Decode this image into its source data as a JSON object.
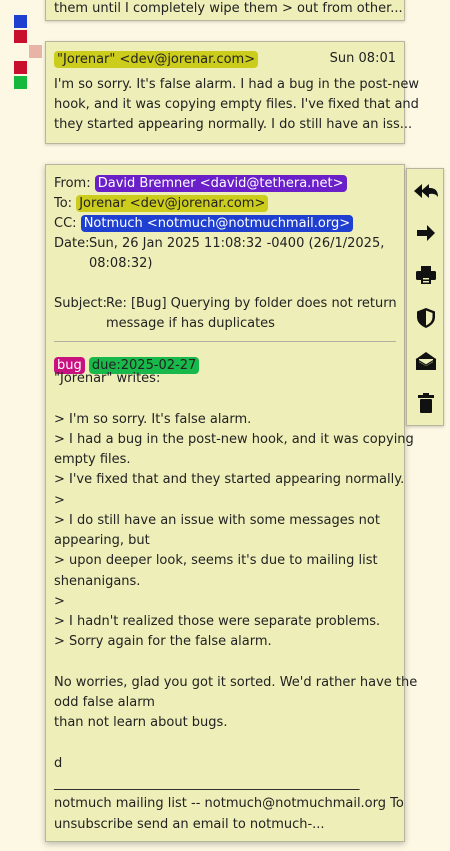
{
  "top_snippet": "them until I completely wipe them > out from other...",
  "color_squares": [
    {
      "name": "blue",
      "color": "#1f3fd0"
    },
    {
      "name": "crimson",
      "color": "#c8102e"
    },
    {
      "name": "pink",
      "color": "#e8b4a8"
    },
    {
      "name": "crimson2",
      "color": "#c8102e"
    },
    {
      "name": "green",
      "color": "#14b83c"
    }
  ],
  "msg1": {
    "from": "\"Jorenar\" <dev@jorenar.com>",
    "date": "Sun 08:01",
    "preview_line1": "I'm so sorry. It's false alarm. I had a bug in the post-new",
    "preview_line2": "hook, and it was copying empty files. I've fixed that and",
    "preview_line3": "they started appearing normally. I do still have an iss..."
  },
  "msg2": {
    "from_label": "From:",
    "from": "David Bremner <david@tethera.net>",
    "to_label": "To:",
    "to": "Jorenar <dev@jorenar.com>",
    "cc_label": "CC:",
    "cc": "Notmuch <notmuch@notmuchmail.org>",
    "date_label": "Date:",
    "date_line1": "Sun, 26 Jan 2025 11:08:32 -0400 (26/1/2025,",
    "date_line2": "08:08:32)",
    "subject_label": "Subject:",
    "subject_line1": "Re: [Bug] Querying by folder does not return",
    "subject_line2": "message if has duplicates",
    "tag1": "bug",
    "tag2": "due:2025-02-27",
    "body": "\"Jorenar\" writes:\n\n> I'm so sorry. It's false alarm.\n> I had a bug in the post-new hook, and it was copying\nempty files.\n> I've fixed that and they started appearing normally.\n>\n> I do still have an issue with some messages not\nappearing, but\n> upon deeper look, seems it's due to mailing list\nshenanigans.\n>\n> I hadn't realized those were separate problems.\n> Sorry again for the false alarm.\n\nNo worries, glad you got it sorted. We'd rather have the\nodd false alarm\nthan not learn about bugs.\n\nd\n_______________________________________________\nnotmuch mailing list -- notmuch@notmuchmail.org To\nunsubscribe send an email to notmuch-..."
  },
  "colors": {
    "background": "#fcf8e3",
    "card": "#eeeeb9",
    "yellow_tag": "#cccc1c",
    "purple_tag": "#6a1fc8",
    "blue_tag": "#1f3fd0",
    "magenta_tag": "#c8107e",
    "green_tag": "#18b84a"
  },
  "toolbar": [
    "reply-all-icon",
    "forward-icon",
    "print-icon",
    "security-shield-icon",
    "mark-unread-icon",
    "delete-trash-icon"
  ]
}
